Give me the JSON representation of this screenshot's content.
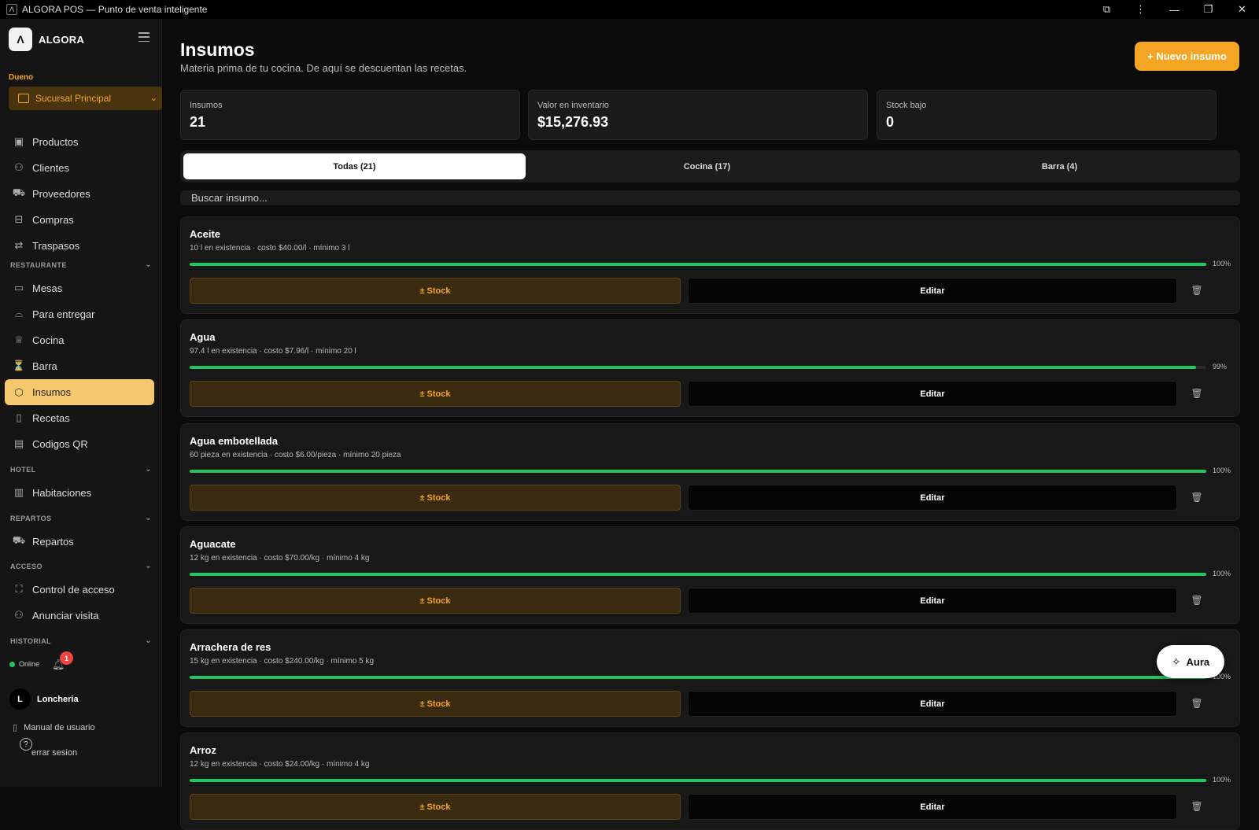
{
  "window": {
    "title": "ALGORA POS — Punto de venta inteligente",
    "controls": [
      "puzzle-icon",
      "kebab-icon",
      "minimize-icon",
      "restore-icon",
      "close-icon"
    ]
  },
  "sidebar": {
    "brand": "ALGORA",
    "role": "Dueno",
    "branch": "Sucursal Principal",
    "items_top": [
      {
        "label": "Productos",
        "icon": "box-icon"
      },
      {
        "label": "Clientes",
        "icon": "users-icon"
      },
      {
        "label": "Proveedores",
        "icon": "truck-icon"
      },
      {
        "label": "Compras",
        "icon": "inbox-icon"
      },
      {
        "label": "Traspasos",
        "icon": "swap-icon"
      }
    ],
    "sections": {
      "restaurante": "RESTAURANTE",
      "hotel": "HOTEL",
      "repartos": "REPARTOS",
      "acceso": "ACCESO",
      "historial": "HISTORIAL"
    },
    "items_restaurante": [
      {
        "label": "Mesas",
        "icon": "table-icon"
      },
      {
        "label": "Para entregar",
        "icon": "bell-tray-icon"
      },
      {
        "label": "Cocina",
        "icon": "chef-hat-icon"
      },
      {
        "label": "Barra",
        "icon": "glass-icon"
      },
      {
        "label": "Insumos",
        "icon": "package-icon",
        "active": true
      },
      {
        "label": "Recetas",
        "icon": "book-icon"
      },
      {
        "label": "Codigos QR",
        "icon": "qr-icon"
      }
    ],
    "item_hotel": {
      "label": "Habitaciones",
      "icon": "building-icon"
    },
    "item_repartos": {
      "label": "Repartos",
      "icon": "truck-icon"
    },
    "items_acceso": [
      {
        "label": "Control de acceso",
        "icon": "scan-icon"
      },
      {
        "label": "Anunciar visita",
        "icon": "users-icon"
      }
    ],
    "status": "Online",
    "notifications": "1",
    "user_initial": "L",
    "user_name": "Loncheria",
    "manual": "Manual de usuario",
    "logout": "errar sesion"
  },
  "header": {
    "title": "Insumos",
    "subtitle": "Materia prima de tu cocina. De aquí se descuentan las recetas.",
    "new_button": "+ Nuevo insumo"
  },
  "stats": [
    {
      "label": "Insumos",
      "value": "21"
    },
    {
      "label": "Valor en inventario",
      "value": "$15,276.93"
    },
    {
      "label": "Stock bajo",
      "value": "0"
    }
  ],
  "tabs": [
    "Todas (21)",
    "Cocina (17)",
    "Barra (4)"
  ],
  "search": {
    "placeholder": "Buscar insumo..."
  },
  "buttons": {
    "stock": "± Stock",
    "edit": "Editar"
  },
  "items": [
    {
      "name": "Aceite",
      "info": "10 l en existencia · costo $40.00/l · mínimo 3 l",
      "percent": 100,
      "percent_label": "100%"
    },
    {
      "name": "Agua",
      "info": "97.4 l en existencia · costo $7.96/l · mínimo 20 l",
      "percent": 99,
      "percent_label": "99%"
    },
    {
      "name": "Agua embotellada",
      "info": "60 pieza en existencia · costo $6.00/pieza · mínimo 20 pieza",
      "percent": 100,
      "percent_label": "100%"
    },
    {
      "name": "Aguacate",
      "info": "12 kg en existencia · costo $70.00/kg · mínimo 4 kg",
      "percent": 100,
      "percent_label": "100%"
    },
    {
      "name": "Arrachera de res",
      "info": "15 kg en existencia · costo $240.00/kg · mínimo 5 kg",
      "percent": 100,
      "percent_label": "100%"
    },
    {
      "name": "Arroz",
      "info": "12 kg en existencia · costo $24.00/kg · mínimo 4 kg",
      "percent": 100,
      "percent_label": "100%"
    }
  ],
  "aura": "Aura",
  "colors": {
    "accent": "#f5a524",
    "progress": "#22c55e",
    "active_nav": "#f5c76f",
    "badge": "#ef4444"
  }
}
